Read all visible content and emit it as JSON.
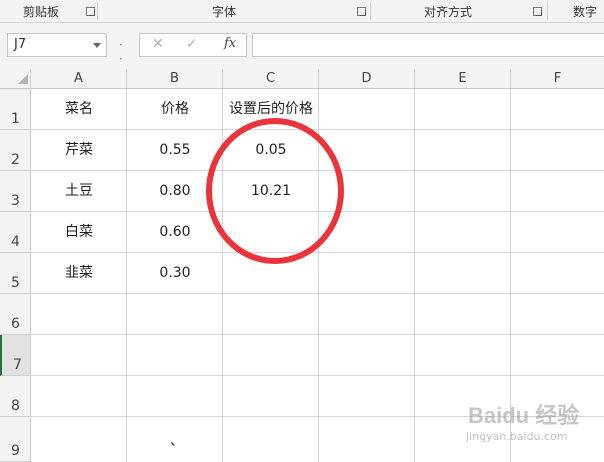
{
  "ribbon": {
    "groups": [
      {
        "label": "剪贴板"
      },
      {
        "label": "字体"
      },
      {
        "label": "对齐方式"
      },
      {
        "label": "数字"
      }
    ]
  },
  "formula_bar": {
    "name_box": "J7",
    "cancel_symbol": "✕",
    "enter_symbol": "✓",
    "fx_label": "fx",
    "formula": ""
  },
  "sheet": {
    "columns": [
      "A",
      "B",
      "C",
      "D",
      "E",
      "F"
    ],
    "rows": [
      "1",
      "2",
      "3",
      "4",
      "5",
      "6",
      "7",
      "8",
      "9"
    ],
    "active_row": "7",
    "cells": {
      "A1": "菜名",
      "B1": "价格",
      "C1": "设置后的价格",
      "A2": "芹菜",
      "B2": "0.55",
      "C2": "0.05",
      "A3": "土豆",
      "B3": "0.80",
      "C3": "10.21",
      "A4": "白菜",
      "B4": "0.60",
      "A5": "韭菜",
      "B5": "0.30"
    },
    "stray_mark": "、"
  },
  "annotation": {
    "circle_color": "#e8343a"
  },
  "watermark": {
    "text": "Baidu 经验",
    "url": "jingyan.baidu.com"
  }
}
